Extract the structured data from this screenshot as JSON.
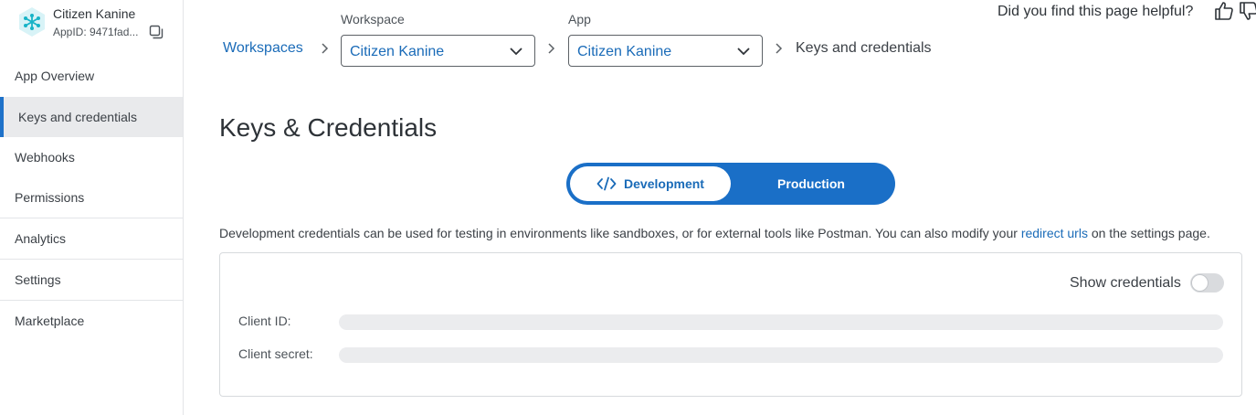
{
  "app": {
    "name": "Citizen Kanine",
    "app_id": "AppID: 9471fad..."
  },
  "sidebar": {
    "items": [
      {
        "label": "App Overview"
      },
      {
        "label": "Keys and credentials",
        "active": true
      },
      {
        "label": "Webhooks"
      },
      {
        "label": "Permissions"
      },
      {
        "label": "Analytics"
      },
      {
        "label": "Settings"
      },
      {
        "label": "Marketplace"
      }
    ]
  },
  "breadcrumb": {
    "workspaces_link": "Workspaces",
    "workspace_label": "Workspace",
    "workspace_value": "Citizen Kanine",
    "app_label": "App",
    "app_value": "Citizen Kanine",
    "current": "Keys and credentials"
  },
  "feedback": {
    "question": "Did you find this page helpful?"
  },
  "main": {
    "title": "Keys & Credentials",
    "env_toggle": {
      "development": "Development",
      "production": "Production",
      "selected": "Development"
    },
    "description_prefix": "Development credentials can be used for testing in environments like sandboxes, or for external tools like Postman. You can also modify your ",
    "description_link": "redirect urls",
    "description_suffix": " on the settings page.",
    "show_credentials_label": "Show credentials",
    "show_credentials_on": false,
    "client_id_label": "Client ID:",
    "client_secret_label": "Client secret:"
  },
  "colors": {
    "accent": "#1a6fc7",
    "link": "#1a6bb8",
    "active_bar": "#1f72c9"
  }
}
